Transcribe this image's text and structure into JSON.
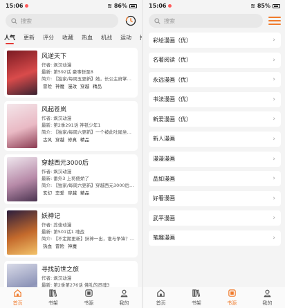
{
  "left": {
    "status": {
      "time": "15:06",
      "battery": "86%"
    },
    "search": {
      "placeholder": "搜索"
    },
    "tabs": [
      "人气",
      "更新",
      "评分",
      "收藏",
      "热血",
      "机战",
      "运动",
      "推"
    ],
    "active_tab": "人气",
    "comics": [
      {
        "title": "风逆天下",
        "author": "作者: 飒汉动漫",
        "latest": "最新: 第592话 豪事斩至8",
        "intro": "简介: 【独家/每周五更新】她，长公主府掌…",
        "tags": [
          "冒险",
          "神魔",
          "漫改",
          "穿越",
          "精品"
        ],
        "cover_colors": [
          "#7a1a22",
          "#d94b4b",
          "#3a2230"
        ]
      },
      {
        "title": "风起苍岚",
        "author": "作者: 飒汉动漫",
        "latest": "最新: 第2季291话 神祇少年1",
        "intro": "简介: 【独家/每周六更新】一个被此吐尾坐…",
        "tags": [
          "古风",
          "穿越",
          "修真",
          "精品"
        ],
        "cover_colors": [
          "#f4e6ea",
          "#e9b9c4",
          "#8b3b52"
        ]
      },
      {
        "title": "穿越西元3000后",
        "author": "作者: 飒汉动漫",
        "latest": "最新: 番外3 上将傻娇了",
        "intro": "简介: 【独家/每周六更新】穿越西元3000后…",
        "tags": [
          "玄幻",
          "恋爱",
          "穿越",
          "精品"
        ],
        "cover_colors": [
          "#efe7ee",
          "#b78aa8",
          "#4a3350"
        ]
      },
      {
        "title": "妖神记",
        "author": "作者: 蕊佳动漫",
        "latest": "最新: 第501话1 魂战",
        "intro": "简介: 【不定期更新】妖神一出，谁与争锋？…",
        "tags": [
          "热血",
          "冒险",
          "神魔"
        ],
        "cover_colors": [
          "#2b1d3d",
          "#c46a2c",
          "#f3c36a"
        ]
      },
      {
        "title": "寻找前世之旅",
        "author": "作者: 飒汉动漫",
        "latest": "最新: 第2季第276话 佛礼的灵魂3",
        "intro": "",
        "tags": [],
        "cover_colors": [
          "#d9dbe8",
          "#8d94b8",
          "#f0f0f4"
        ]
      }
    ],
    "nav": [
      {
        "label": "首页",
        "icon": "home-icon",
        "active": true
      },
      {
        "label": "书架",
        "icon": "bookshelf-icon",
        "active": false
      },
      {
        "label": "书源",
        "icon": "book-source-icon",
        "active": false
      },
      {
        "label": "我的",
        "icon": "profile-icon",
        "active": false
      }
    ]
  },
  "right": {
    "status": {
      "time": "15:06",
      "battery": "85%"
    },
    "search": {
      "placeholder": "搜索"
    },
    "sources": [
      "彩绘漫画（优）",
      "名著阅读（优）",
      "永远漫画（优）",
      "书法漫画（优）",
      "新爱漫画（优）",
      "新人漫画",
      "漫漫漫画",
      "品如漫画",
      "好看漫画",
      "武平漫画",
      "笔趣漫画"
    ],
    "nav": [
      {
        "label": "首页",
        "icon": "home-icon",
        "active": false
      },
      {
        "label": "书架",
        "icon": "bookshelf-icon",
        "active": false
      },
      {
        "label": "书源",
        "icon": "book-source-icon",
        "active": true
      },
      {
        "label": "我的",
        "icon": "profile-icon",
        "active": false
      }
    ]
  },
  "colors": {
    "accent": "#f07b2c",
    "tab_indicator": "#e53935",
    "background": "#f4f4f4"
  }
}
